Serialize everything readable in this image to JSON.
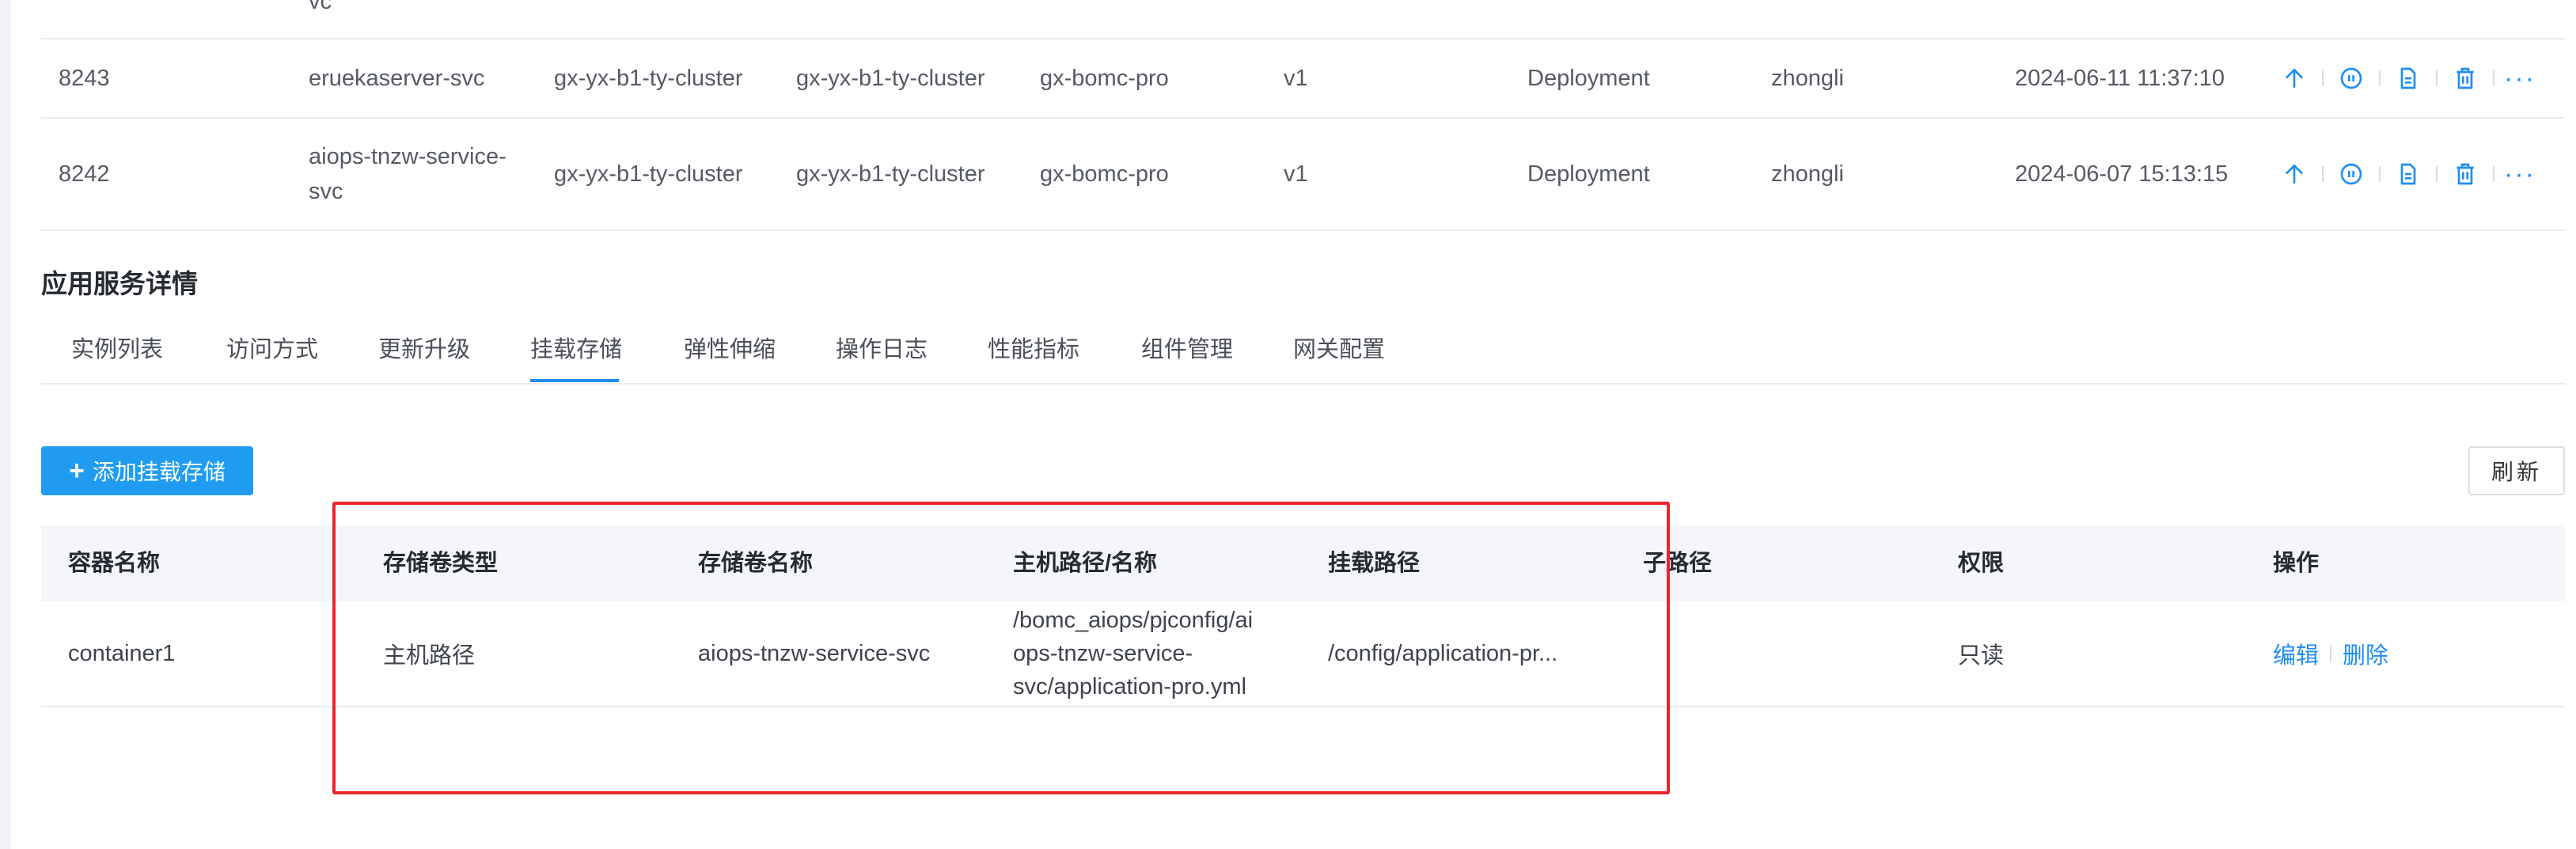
{
  "deployments": [
    {
      "id": "",
      "name_lines": [
        "vc"
      ],
      "cluster": "",
      "cluster2": "",
      "namespace": "",
      "version": "",
      "kind": "",
      "user": "",
      "time": ""
    },
    {
      "id": "8243",
      "name_lines": [
        "eruekaserver-svc"
      ],
      "cluster": "gx-yx-b1-ty-cluster",
      "cluster2": "gx-yx-b1-ty-cluster",
      "namespace": "gx-bomc-pro",
      "version": "v1",
      "kind": "Deployment",
      "user": "zhongli",
      "time": "2024-06-11 11:37:10"
    },
    {
      "id": "8242",
      "name_lines": [
        "aiops-tnzw-service-",
        "svc"
      ],
      "cluster": "gx-yx-b1-ty-cluster",
      "cluster2": "gx-yx-b1-ty-cluster",
      "namespace": "gx-bomc-pro",
      "version": "v1",
      "kind": "Deployment",
      "user": "zhongli",
      "time": "2024-06-07 15:13:15"
    }
  ],
  "row_actions": {
    "more": "···"
  },
  "detail": {
    "title": "应用服务详情",
    "tabs": [
      "实例列表",
      "访问方式",
      "更新升级",
      "挂载存储",
      "弹性伸缩",
      "操作日志",
      "性能指标",
      "组件管理",
      "网关配置"
    ],
    "active_tab": "挂载存储"
  },
  "toolbar": {
    "add_label": "添加挂载存储",
    "add_icon": "+",
    "refresh_label": "刷新"
  },
  "mount_table": {
    "headers": [
      "容器名称",
      "存储卷类型",
      "存储卷名称",
      "主机路径/名称",
      "挂载路径",
      "子路径",
      "权限",
      "操作"
    ],
    "rows": [
      {
        "container": "container1",
        "volume_type": "主机路径",
        "volume_name": "aiops-tnzw-service-svc",
        "host_path_lines": [
          "/bomc_aiops/pjconfig/ai",
          "ops-tnzw-service-",
          "svc/application-pro.yml"
        ],
        "mount_path": "/config/application-pr...",
        "sub_path": "",
        "permission": "只读",
        "edit_label": "编辑",
        "delete_label": "删除"
      }
    ]
  },
  "colors": {
    "accent": "#1f8ef1",
    "highlight": "#e8262b"
  }
}
